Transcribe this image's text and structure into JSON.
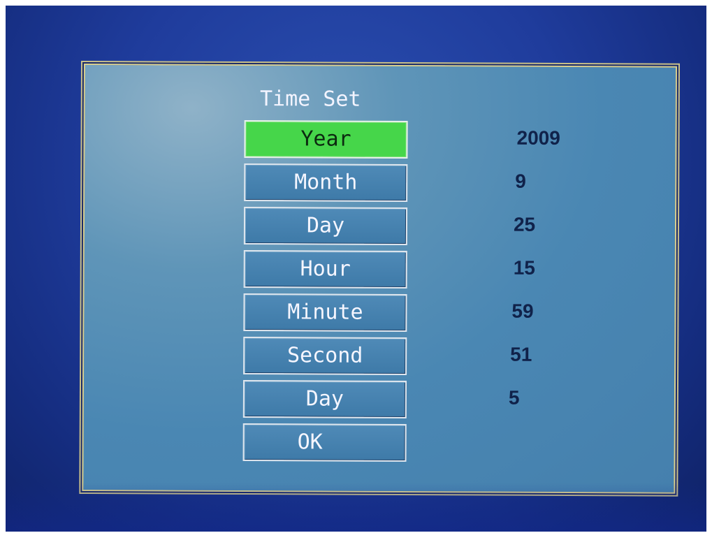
{
  "dialog": {
    "title": "Time Set"
  },
  "fields": [
    {
      "label": "Year",
      "value": "2009",
      "selected": true
    },
    {
      "label": "Month",
      "value": "9",
      "selected": false
    },
    {
      "label": "Day",
      "value": "25",
      "selected": false
    },
    {
      "label": "Hour",
      "value": "15",
      "selected": false
    },
    {
      "label": "Minute",
      "value": "59",
      "selected": false
    },
    {
      "label": "Second",
      "value": "51",
      "selected": false
    },
    {
      "label": "Day",
      "value": "5",
      "selected": false
    }
  ],
  "ok_button": {
    "label": "OK"
  },
  "colors": {
    "selected_highlight": "#46d64a",
    "button_background": "#3e7aa8",
    "dialog_background": "#4a87b3",
    "screen_background": "#1f3c9c"
  }
}
